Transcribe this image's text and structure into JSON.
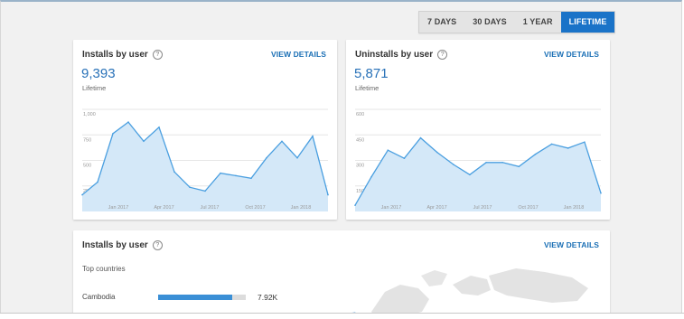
{
  "range": {
    "options": [
      "7 DAYS",
      "30 DAYS",
      "1 YEAR",
      "LIFETIME"
    ],
    "selected": "LIFETIME"
  },
  "installs_card": {
    "title": "Installs by user",
    "view_details": "VIEW DETAILS",
    "value": "9,393",
    "sub_label": "Lifetime"
  },
  "uninstalls_card": {
    "title": "Uninstalls by user",
    "view_details": "VIEW DETAILS",
    "value": "5,871",
    "sub_label": "Lifetime"
  },
  "countries_card": {
    "title": "Installs by user",
    "view_details": "VIEW DETAILS",
    "subtitle": "Top countries",
    "rows": [
      {
        "country": "Cambodia",
        "value": "7.92K",
        "fraction": 0.85
      }
    ]
  },
  "colors": {
    "accent": "#1a73c8",
    "line": "#4a9fe0",
    "area": "#d4e8f8"
  },
  "chart_data": [
    {
      "type": "area",
      "title": "Installs by user",
      "x": [
        "2016-10",
        "2016-11",
        "2016-12",
        "2017-01",
        "2017-02",
        "2017-03",
        "2017-04",
        "2017-05",
        "2017-06",
        "2017-07",
        "2017-08",
        "2017-09",
        "2017-10",
        "2017-11",
        "2017-12",
        "2018-01",
        "2018-02"
      ],
      "y": [
        330,
        430,
        810,
        900,
        750,
        860,
        510,
        390,
        360,
        500,
        480,
        460,
        620,
        750,
        620,
        790,
        330
      ],
      "x_tick_labels": [
        "Jan 2017",
        "Apr 2017",
        "Jul 2017",
        "Oct 2017",
        "Jan 2018"
      ],
      "y_tick_labels": [
        "1,000",
        "750",
        "500",
        "250"
      ],
      "ylim": [
        200,
        1000
      ],
      "grid": true
    },
    {
      "type": "area",
      "title": "Uninstalls by user",
      "x": [
        "2016-10",
        "2016-11",
        "2016-12",
        "2017-01",
        "2017-02",
        "2017-03",
        "2017-04",
        "2017-05",
        "2017-06",
        "2017-07",
        "2017-08",
        "2017-09",
        "2017-10",
        "2017-11",
        "2017-12",
        "2018-01",
        "2018-02"
      ],
      "y": [
        130,
        270,
        400,
        360,
        460,
        390,
        330,
        280,
        340,
        340,
        320,
        380,
        430,
        410,
        440,
        190
      ],
      "x_tick_labels": [
        "Jan 2017",
        "Apr 2017",
        "Jul 2017",
        "Oct 2017",
        "Jan 2018"
      ],
      "y_tick_labels": [
        "600",
        "450",
        "300",
        "150"
      ],
      "ylim": [
        100,
        600
      ],
      "grid": true
    }
  ]
}
